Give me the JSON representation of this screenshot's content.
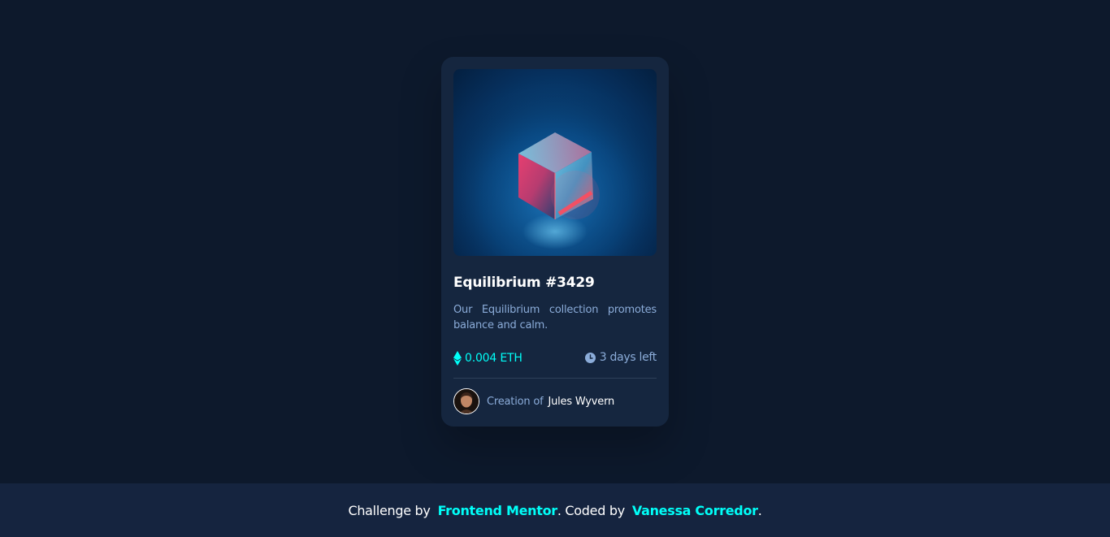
{
  "card": {
    "image_alt": "equilibrium",
    "title": "Equilibrium #3429",
    "description": "Our Equilibrium collection promotes balance and calm.",
    "price": "0.004 ETH",
    "time_left": "3 days left",
    "creator_prefix": "Creation of",
    "creator_name": "Jules Wyvern"
  },
  "footer": {
    "prefix": "Challenge by",
    "challenge_link": "Frontend Mentor",
    "middle": ". Coded by",
    "author_link": "Vanessa Corredor",
    "suffix": "."
  },
  "icons": {
    "price": "ethereum-icon",
    "time": "clock-icon"
  },
  "colors": {
    "background": "#0d192c",
    "card": "#15263f",
    "accent": "#00fff8",
    "muted_text": "#8bacd9",
    "footer": "#15243f"
  }
}
